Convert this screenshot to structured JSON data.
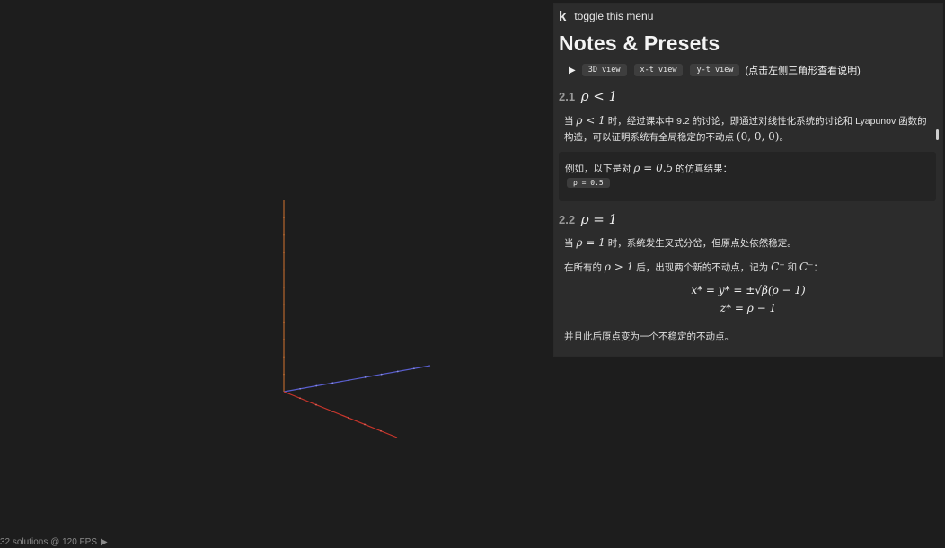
{
  "status": {
    "text": "32 solutions @ 120 FPS",
    "play_glyph": "▶"
  },
  "panel": {
    "menu_key": "k",
    "menu_hint": "toggle this menu",
    "title": "Notes & Presets",
    "views": {
      "expand_glyph": "▶",
      "buttons": [
        "3D view",
        "x-t view",
        "y-t view"
      ],
      "hint": "(点击左侧三角形查看说明)"
    },
    "section_1": {
      "number": "2.1",
      "heading_math": "ρ < 1",
      "para_prefix": "当",
      "para_math1": "ρ < 1",
      "para_mid": "时，经过课本中 9.2 的讨论，即通过对线性化系统的讨论和 Lyapunov 函数的构造，可以证明系统有全局稳定的不动点",
      "para_math2": "(0, 0, 0)",
      "para_suffix": "。",
      "example_prefix": "例如，以下是对",
      "example_math": "ρ = 0.5",
      "example_suffix": "的仿真结果：",
      "example_button": "ρ = 0.5"
    },
    "section_2": {
      "number": "2.2",
      "heading_math": "ρ = 1",
      "para1_prefix": "当",
      "para1_math": "ρ = 1",
      "para1_suffix": "时，系统发生叉式分岔，但原点处依然稳定。",
      "para2_prefix": "在所有的",
      "para2_math": "ρ > 1",
      "para2_mid": "后，出现两个新的不动点，记为",
      "para2_math2": "C⁺",
      "para2_and": "和",
      "para2_math3": "C⁻",
      "para2_suffix": "：",
      "formula1": "x* = y* = ±√β(ρ − 1)",
      "formula2": "z* = ρ − 1",
      "para3": "并且此后原点变为一个不稳定的不动点。"
    }
  },
  "colors": {
    "background": "#1d1d1d",
    "panel": "#2c2c2c",
    "axis_z": "#b5652d",
    "axis_y": "#5a5fd0",
    "axis_x": "#c8352b"
  }
}
